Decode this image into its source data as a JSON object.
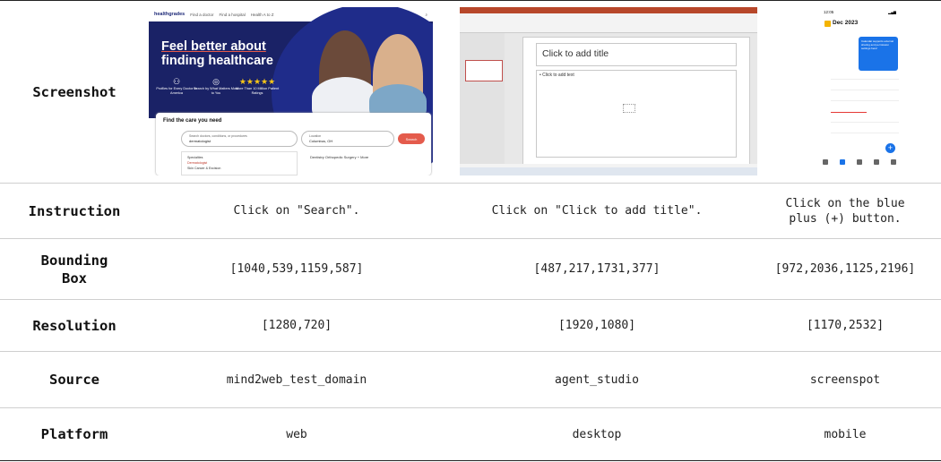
{
  "headers": {
    "screenshot": "Screenshot",
    "instruction": "Instruction",
    "bounding_box": "Bounding Box",
    "resolution": "Resolution",
    "source": "Source",
    "platform": "Platform"
  },
  "examples": [
    {
      "instruction": "Click on \"Search\".",
      "bounding_box": "[1040,539,1159,587]",
      "resolution": "[1280,720]",
      "source": "mind2web_test_domain",
      "platform": "web"
    },
    {
      "instruction": "Click on \"Click to add title\".",
      "bounding_box": "[487,217,1731,377]",
      "resolution": "[1920,1080]",
      "source": "agent_studio",
      "platform": "desktop"
    },
    {
      "instruction": "Click on the blue plus (+) button.",
      "bounding_box": "[972,2036,1125,2196]",
      "resolution": "[1170,2532]",
      "source": "screenspot",
      "platform": "mobile"
    }
  ],
  "healthgrades": {
    "logo": "healthgrades",
    "nav": [
      "Find a doctor",
      "Find a hospital",
      "Health A to Z"
    ],
    "login": "Log In",
    "title_line1": "Feel better about",
    "title_line2": "finding healthcare",
    "stats": [
      {
        "icon": "people-icon",
        "text": "Profiles for Every Doctor in America"
      },
      {
        "icon": "search-person-icon",
        "text": "Search by What Matters Most to You"
      },
      {
        "icon": "stars-icon",
        "text": "More Than 10 Million Patient Ratings"
      }
    ],
    "card_title": "Find the care you need",
    "search_label": "Search doctors, conditions, or procedures",
    "search_value": "dermatologist",
    "location_label": "Location",
    "location_value": "Columbus, OH",
    "search_button": "Search",
    "dropdown_header": "Specialties",
    "dropdown_item1": "Dermatologist",
    "dropdown_item2": "Skin Cancer & Excision",
    "links": "Dentistry   Orthopedic Surgery   + More"
  },
  "powerpoint": {
    "title_placeholder": "Click to add title",
    "body_placeholder": "• Click to add text"
  },
  "calendar": {
    "time": "12:05",
    "header": "Dec 2023",
    "tooltip": "Calendar supports external sharing and permission settings here!",
    "fab": "+"
  }
}
